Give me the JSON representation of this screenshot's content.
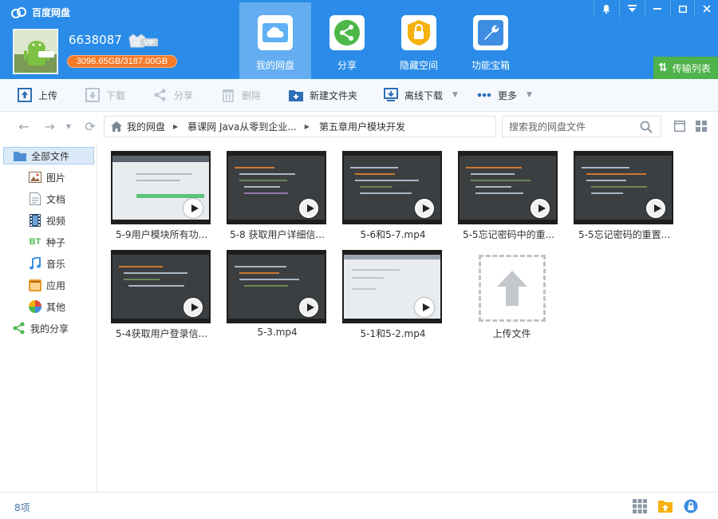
{
  "app": {
    "title": "百度网盘",
    "username": "6638087",
    "vip": "VIP",
    "quota": "3096.65GB/3187.00GB"
  },
  "nav_tabs": [
    {
      "label": "我的网盘",
      "icon": "cloud-icon"
    },
    {
      "label": "分享",
      "icon": "share-icon"
    },
    {
      "label": "隐藏空间",
      "icon": "lock-icon"
    },
    {
      "label": "功能宝箱",
      "icon": "wrench-icon"
    }
  ],
  "transfer": {
    "label": "传输列表"
  },
  "toolbar": {
    "upload": "上传",
    "download": "下载",
    "share": "分享",
    "delete": "删除",
    "new_folder": "新建文件夹",
    "offline_download": "离线下载",
    "more": "更多"
  },
  "breadcrumb": [
    "我的网盘",
    "慕课网 Java从零到企业...",
    "第五章用户模块开发"
  ],
  "search": {
    "placeholder": "搜索我的网盘文件"
  },
  "sidebar": {
    "items": [
      {
        "label": "全部文件",
        "icon": "folder-icon"
      },
      {
        "label": "图片",
        "icon": "image-icon"
      },
      {
        "label": "文档",
        "icon": "document-icon"
      },
      {
        "label": "视频",
        "icon": "video-icon"
      },
      {
        "label": "种子",
        "icon": "bt-icon"
      },
      {
        "label": "音乐",
        "icon": "music-icon"
      },
      {
        "label": "应用",
        "icon": "app-icon"
      },
      {
        "label": "其他",
        "icon": "other-icon"
      },
      {
        "label": "我的分享",
        "icon": "share-icon"
      }
    ]
  },
  "files": [
    {
      "name": "5-9用户模块所有功...",
      "theme": "light"
    },
    {
      "name": "5-8 获取用户详细信...",
      "theme": "dark"
    },
    {
      "name": "5-6和5-7.mp4",
      "theme": "dark"
    },
    {
      "name": "5-5忘记密码中的重...",
      "theme": "dark"
    },
    {
      "name": "5-5忘记密码的重置...",
      "theme": "dark"
    },
    {
      "name": "5-4获取用户登录信...",
      "theme": "dark"
    },
    {
      "name": "5-3.mp4",
      "theme": "dark"
    },
    {
      "name": "5-1和5-2.mp4",
      "theme": "light"
    }
  ],
  "upload_tile": {
    "label": "上传文件"
  },
  "status": {
    "count": "8项"
  }
}
